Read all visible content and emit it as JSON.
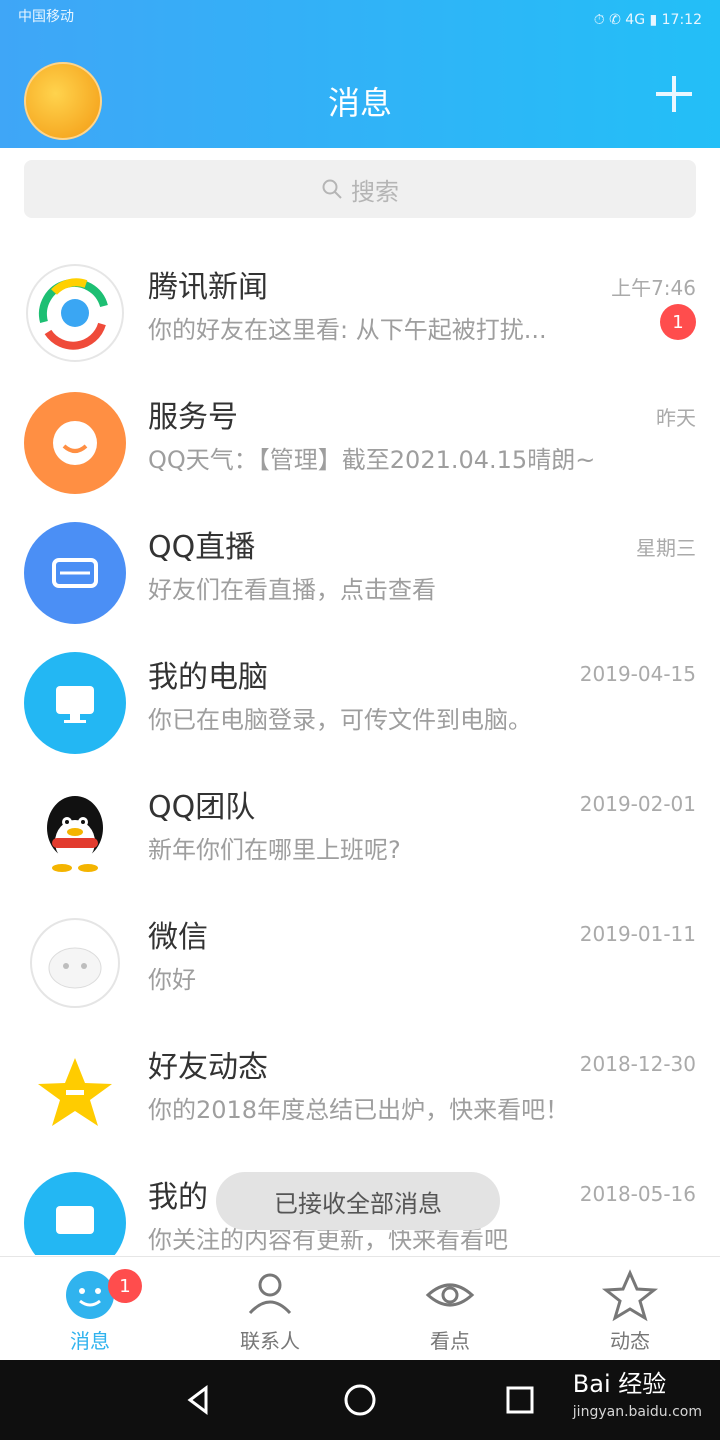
{
  "header": {
    "status_left": "中国移动",
    "status_right": "⏱ ✆ 4G ▮ 17:12",
    "title": "消息"
  },
  "search": {
    "placeholder": "搜索"
  },
  "conversations": [
    {
      "name": "腾讯新闻",
      "time": "上午7:46",
      "preview": "你的好友在这里看: 从下午起被打扰...",
      "badge": "1"
    },
    {
      "name": "服务号",
      "time": "昨天",
      "preview": "QQ天气：【管理】截至2021.04.15晴朗~",
      "badge": ""
    },
    {
      "name": "QQ直播",
      "time": "星期三",
      "preview": "好友们在看直播，点击查看",
      "badge": ""
    },
    {
      "name": "我的电脑",
      "time": "2019-04-15",
      "preview": "你已在电脑登录，可传文件到电脑。",
      "badge": ""
    },
    {
      "name": "QQ团队",
      "time": "2019-02-01",
      "preview": "新年你们在哪里上班呢?",
      "badge": ""
    },
    {
      "name": "微信",
      "time": "2019-01-11",
      "preview": "你好",
      "badge": ""
    },
    {
      "name": "好友动态",
      "time": "2018-12-30",
      "preview": "你的2018年度总结已出炉，快来看吧！",
      "badge": ""
    },
    {
      "name": "我的",
      "time": "2018-05-16",
      "preview": "你关注的内容有更新，快来看看吧",
      "badge": ""
    }
  ],
  "toast": {
    "text": "已接收全部消息"
  },
  "tabs": [
    {
      "label": "消息",
      "badge": "1"
    },
    {
      "label": "联系人"
    },
    {
      "label": "看点"
    },
    {
      "label": "动态"
    }
  ],
  "watermark": {
    "brand": "Bai 经验",
    "url": "jingyan.baidu.com"
  },
  "colors": {
    "header_gradient_start": "#3fa6f7",
    "header_gradient_end": "#23bff7",
    "accent": "#30b3ee",
    "badge_red": "#ff4d4d"
  }
}
